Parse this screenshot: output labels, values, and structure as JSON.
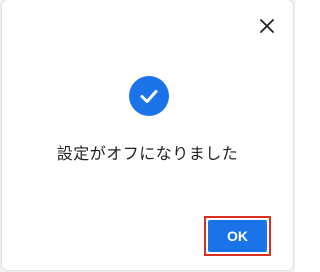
{
  "dialog": {
    "close_icon": "close-icon",
    "status_icon": "check-circle-icon",
    "message": "設定がオフになりました",
    "ok_label": "OK"
  },
  "colors": {
    "accent": "#1a73e8",
    "focus_outline": "#d93025",
    "text": "#202124"
  }
}
